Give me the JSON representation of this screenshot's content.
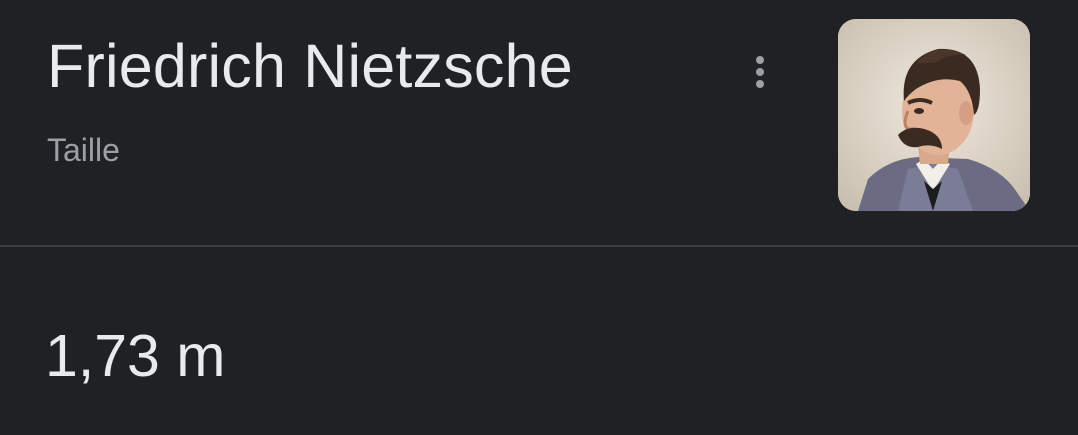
{
  "knowledge_panel": {
    "title": "Friedrich Nietzsche",
    "attribute_label": "Taille",
    "attribute_value": "1,73 m",
    "more_options_icon": "vertical-dots-icon",
    "portrait_alt": "Friedrich Nietzsche"
  },
  "colors": {
    "background": "#202124",
    "primary_text": "#e8eaed",
    "secondary_text": "#9aa0a6",
    "divider": "#3c4043"
  }
}
